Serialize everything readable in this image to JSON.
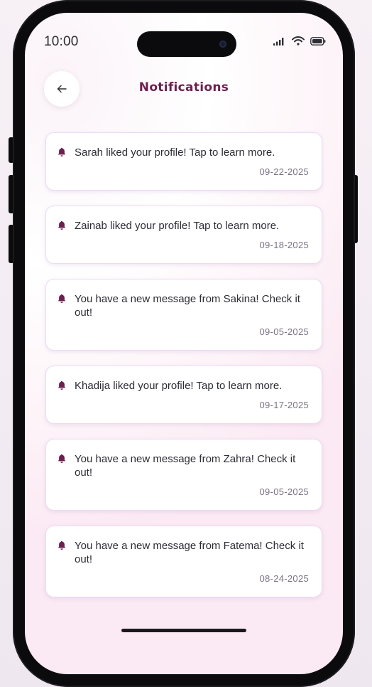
{
  "status_bar": {
    "time": "10:00",
    "icons": [
      "signal-icon",
      "wifi-icon",
      "battery-icon"
    ]
  },
  "header": {
    "back_icon": "arrow-left-icon",
    "title": "Notifications"
  },
  "colors": {
    "title": "#6d1f4e",
    "bell": "#6d1f4e",
    "card_border": "#eadcf3"
  },
  "notifications": [
    {
      "icon": "bell-icon",
      "text": "Sarah liked your profile! Tap to learn more.",
      "date": "09-22-2025"
    },
    {
      "icon": "bell-icon",
      "text": "Zainab liked your profile! Tap to learn more.",
      "date": "09-18-2025"
    },
    {
      "icon": "bell-icon",
      "text": "You have a new message from Sakina! Check it out!",
      "date": "09-05-2025"
    },
    {
      "icon": "bell-icon",
      "text": "Khadija liked your profile! Tap to learn more.",
      "date": "09-17-2025"
    },
    {
      "icon": "bell-icon",
      "text": "You have a new message from Zahra! Check it out!",
      "date": "09-05-2025"
    },
    {
      "icon": "bell-icon",
      "text": "You have a new message from Fatema! Check it out!",
      "date": "08-24-2025"
    }
  ]
}
